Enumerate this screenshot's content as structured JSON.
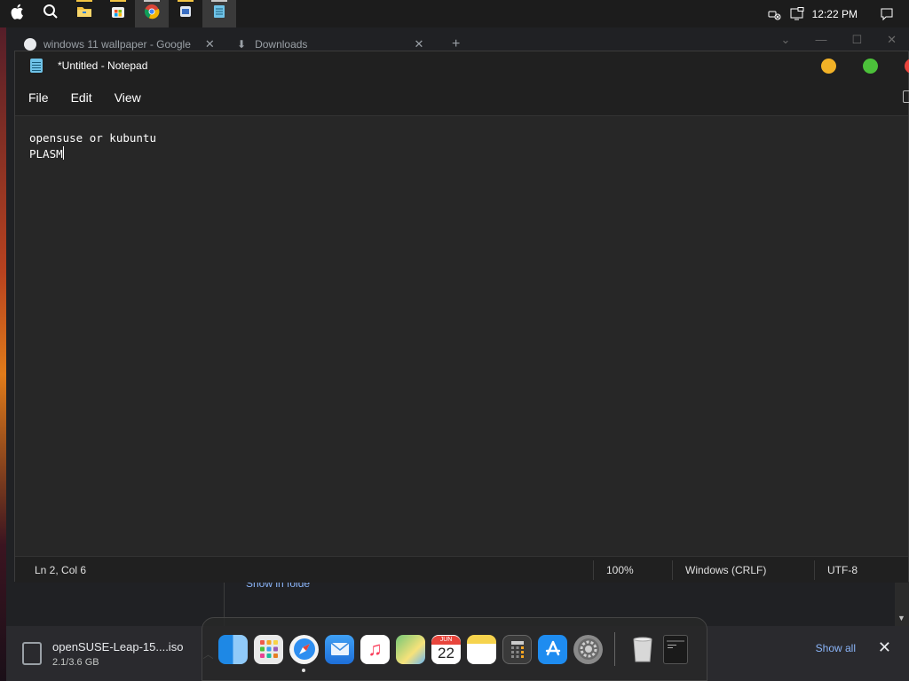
{
  "taskbar": {
    "clock": "12:22 PM",
    "apps": [
      {
        "name": "apple-menu",
        "icon": "apple-icon"
      },
      {
        "name": "search",
        "icon": "search-icon"
      },
      {
        "name": "file-explorer",
        "icon": "folder-icon"
      },
      {
        "name": "microsoft-store",
        "icon": "store-icon"
      },
      {
        "name": "chrome",
        "icon": "chrome-icon"
      },
      {
        "name": "app",
        "icon": "app-icon"
      },
      {
        "name": "notepad",
        "icon": "notepad-icon"
      }
    ]
  },
  "chrome": {
    "tabs": [
      {
        "label": "windows 11 wallpaper - Google"
      },
      {
        "label": "Downloads"
      }
    ],
    "new_tab": "+",
    "show_in_folder": "Show in folde",
    "download": {
      "filename": "openSUSE-Leap-15....iso",
      "progress": "2.1/3.6 GB"
    },
    "show_all": "Show all"
  },
  "notepad": {
    "title": "*Untitled - Notepad",
    "menu": [
      "File",
      "Edit",
      "View"
    ],
    "content_lines": [
      "opensuse or kubuntu",
      "PLASM"
    ],
    "status": {
      "position": "Ln 2, Col 6",
      "zoom": "100%",
      "line_ending": "Windows (CRLF)",
      "encoding": "UTF-8"
    }
  },
  "dock": {
    "calendar_month": "JUN",
    "calendar_day": "22",
    "apps": [
      "finder",
      "launchpad",
      "safari",
      "mail",
      "music",
      "maps",
      "calendar",
      "notes",
      "calculator",
      "app-store",
      "system-preferences",
      "trash",
      "notepad-window"
    ]
  },
  "colors": {
    "accent_link": "#8ab4f8",
    "traffic_yellow": "#f2b227",
    "traffic_green": "#4cc13a",
    "traffic_red": "#e8453c"
  }
}
